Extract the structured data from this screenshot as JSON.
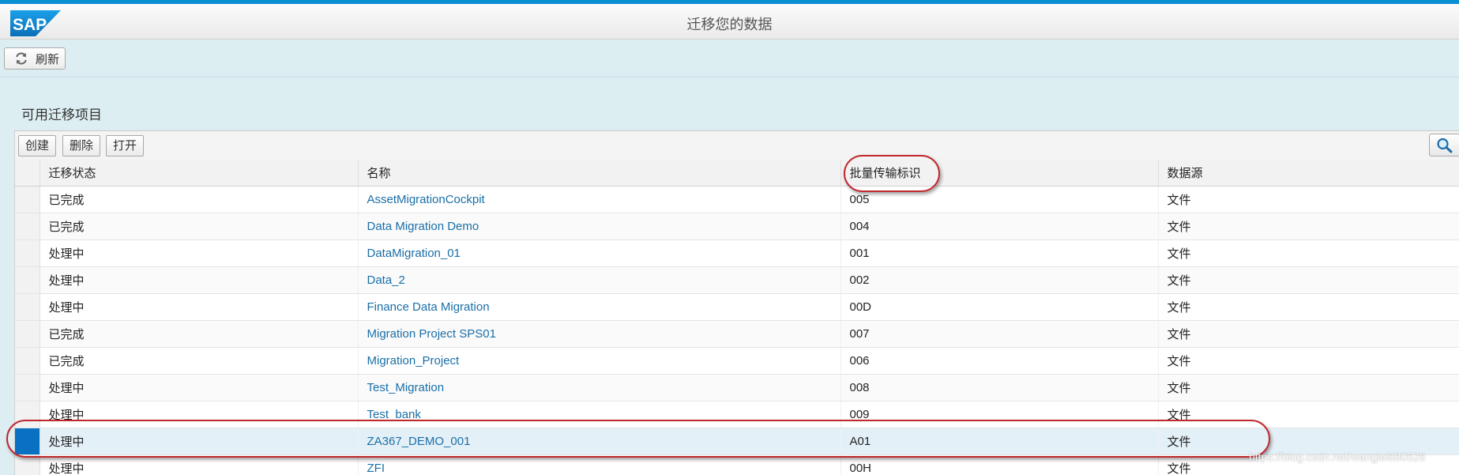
{
  "header": {
    "logo_text": "SAP",
    "title": "迁移您的数据"
  },
  "toolbar": {
    "refresh_label": "刷新",
    "refresh_icon": "refresh-icon"
  },
  "section": {
    "title": "可用迁移项目"
  },
  "table_toolbar": {
    "create_label": "创建",
    "delete_label": "删除",
    "open_label": "打开",
    "search_icon": "search-icon"
  },
  "table": {
    "columns": [
      "迁移状态",
      "名称",
      "批量传输标识",
      "数据源"
    ],
    "rows": [
      {
        "status": "已完成",
        "name": "AssetMigrationCockpit",
        "transfer_id": "005",
        "source": "文件"
      },
      {
        "status": "已完成",
        "name": "Data Migration Demo",
        "transfer_id": "004",
        "source": "文件"
      },
      {
        "status": "处理中",
        "name": "DataMigration_01",
        "transfer_id": "001",
        "source": "文件"
      },
      {
        "status": "处理中",
        "name": "Data_2",
        "transfer_id": "002",
        "source": "文件"
      },
      {
        "status": "处理中",
        "name": "Finance Data Migration",
        "transfer_id": "00D",
        "source": "文件"
      },
      {
        "status": "已完成",
        "name": "Migration Project SPS01",
        "transfer_id": "007",
        "source": "文件"
      },
      {
        "status": "已完成",
        "name": "Migration_Project",
        "transfer_id": "006",
        "source": "文件"
      },
      {
        "status": "处理中",
        "name": "Test_Migration",
        "transfer_id": "008",
        "source": "文件"
      },
      {
        "status": "处理中",
        "name": "Test_bank",
        "transfer_id": "009",
        "source": "文件"
      },
      {
        "status": "处理中",
        "name": "ZA367_DEMO_001",
        "transfer_id": "A01",
        "source": "文件"
      },
      {
        "status": "处理中",
        "name": "ZFI",
        "transfer_id": "00H",
        "source": "文件"
      }
    ],
    "selected_row": 9
  },
  "watermark": "https://blog.csdn.net/wanglei880526",
  "colors": {
    "brand": "#0a8fd2",
    "link": "#1a6fa8",
    "selection": "#0a71c2",
    "annotation": "#c0282e"
  }
}
